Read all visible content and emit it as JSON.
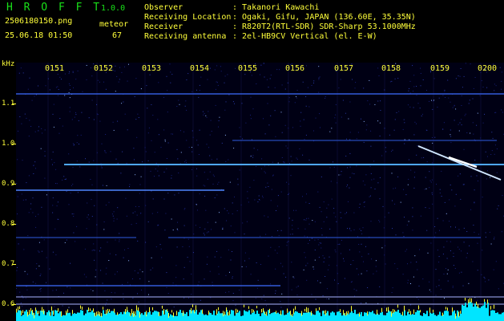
{
  "header": {
    "logo_letters": "H R O F F T",
    "version": "1.0.0",
    "filename": "2506180150.png",
    "event_label": "meteor",
    "datetime": "25.06.18 01:50",
    "event_count": "67",
    "info": [
      {
        "label": "Observer",
        "value": ": Takanori Kawachi"
      },
      {
        "label": "Receiving Location",
        "value": ": Ogaki, Gifu, JAPAN (136.60E, 35.35N)"
      },
      {
        "label": "Receiver",
        "value": ": R820T2(RTL-SDR) SDR-Sharp 53.1000MHz"
      },
      {
        "label": "Receiving antenna",
        "value": ": 2el-HB9CV Vertical (el. E-W)"
      }
    ]
  },
  "axis": {
    "y_unit": "kHz",
    "y_ticks": [
      "1.1",
      "1.0",
      "0.9",
      "0.8",
      "0.7",
      "0.6"
    ],
    "time_ticks": [
      "0151",
      "0152",
      "0153",
      "0154",
      "0155",
      "0156",
      "0157",
      "0158",
      "0159",
      "0200"
    ]
  },
  "colors": {
    "label": "#ffff3a",
    "logo": "#19e019",
    "background": "#000014",
    "signal": "#4fa8ff",
    "noise_floor": "#00e5ff"
  }
}
